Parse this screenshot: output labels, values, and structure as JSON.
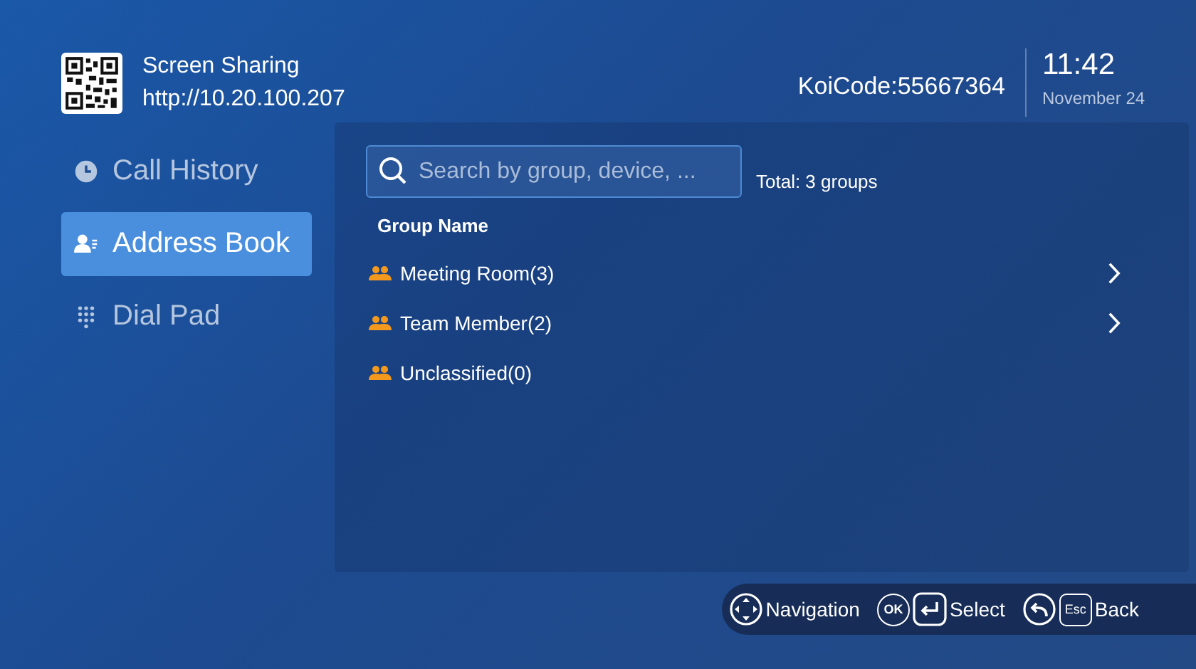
{
  "header": {
    "title": "Screen Sharing",
    "url": "http://10.20.100.207",
    "code": "KoiCode:55667364",
    "time": "11:42",
    "date": "November 24"
  },
  "sidebar": {
    "items": [
      {
        "label": "Call History",
        "kind": "history",
        "selected": false
      },
      {
        "label": "Address Book",
        "kind": "contacts",
        "selected": true
      },
      {
        "label": "Dial Pad",
        "kind": "dialpad",
        "selected": false
      }
    ]
  },
  "search": {
    "placeholder": "Search by group, device, ..."
  },
  "total": "Total: 3 groups",
  "table": {
    "column": "Group Name",
    "rows": [
      {
        "name": "Meeting Room(3)",
        "openable": true
      },
      {
        "name": "Team Member(2)",
        "openable": true
      },
      {
        "name": "Unclassified(0)",
        "openable": false
      }
    ]
  },
  "hints": [
    {
      "kind": "nav",
      "label": "Navigation"
    },
    {
      "kind": "select",
      "key": "OK",
      "label": "Select"
    },
    {
      "kind": "back",
      "key": "Esc",
      "label": "Back"
    }
  ]
}
